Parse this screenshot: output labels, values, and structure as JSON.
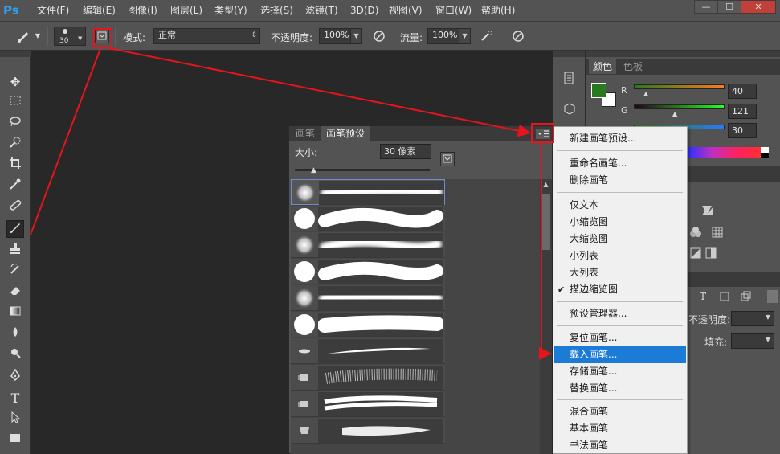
{
  "app": {
    "logo": "Ps"
  },
  "menubar": {
    "items": [
      "文件(F)",
      "编辑(E)",
      "图像(I)",
      "图层(L)",
      "类型(Y)",
      "选择(S)",
      "滤镜(T)",
      "3D(D)",
      "视图(V)",
      "窗口(W)",
      "帮助(H)"
    ],
    "window_buttons": [
      "—",
      "☐",
      "✕"
    ]
  },
  "options_bar": {
    "brush_size": "30",
    "mode_label": "模式:",
    "mode_value": "正常",
    "opacity_label": "不透明度:",
    "opacity_value": "100%",
    "flow_label": "流量:",
    "flow_value": "100%"
  },
  "toolbar": {
    "tools": [
      "move-icon",
      "marquee-icon",
      "lasso-icon",
      "quick-select-icon",
      "crop-icon",
      "eyedropper-icon",
      "healing-icon",
      "brush-icon",
      "stamp-icon",
      "history-brush-icon",
      "eraser-icon",
      "gradient-icon",
      "blur-icon",
      "dodge-icon",
      "pen-icon",
      "type-icon",
      "path-select-icon",
      "rectangle-icon"
    ],
    "active_tool": "brush-icon"
  },
  "color_panel": {
    "tabs": [
      "颜色",
      "色板"
    ],
    "channels": [
      {
        "label": "R",
        "value": "40"
      },
      {
        "label": "G",
        "value": "121"
      },
      {
        "label": "B",
        "value": "30"
      }
    ],
    "foreground": "#287a1e",
    "background": "#ffffff"
  },
  "layers_panel": {
    "opacity_label": "不透明度:",
    "fill_label": "填充:"
  },
  "brush_panel": {
    "tabs": [
      "画笔",
      "画笔预设"
    ],
    "active_tab": "画笔预设",
    "size_label": "大小:",
    "size_value": "30 像素",
    "presets": [
      "soft-round",
      "hard-round",
      "soft-round",
      "hard-round",
      "soft-round",
      "hard-round",
      "calligraphy",
      "spatter",
      "chalk",
      "dry-media",
      "charcoal",
      "bristle"
    ]
  },
  "flyout_menu": {
    "groups": [
      [
        "新建画笔预设..."
      ],
      [
        "重命名画笔...",
        "删除画笔"
      ],
      [
        "仅文本",
        "小缩览图",
        "大缩览图",
        "小列表",
        "大列表",
        "描边缩览图"
      ],
      [
        "预设管理器..."
      ],
      [
        "复位画笔...",
        "载入画笔...",
        "存储画笔...",
        "替换画笔..."
      ],
      [
        "混合画笔",
        "基本画笔",
        "书法画笔"
      ]
    ],
    "checked_item": "描边缩览图",
    "highlighted_item": "载入画笔..."
  },
  "colors": {
    "annotation": "#e8141c",
    "menu_highlight": "#1c7bd6",
    "ps_blue": "#2fa3f6"
  }
}
